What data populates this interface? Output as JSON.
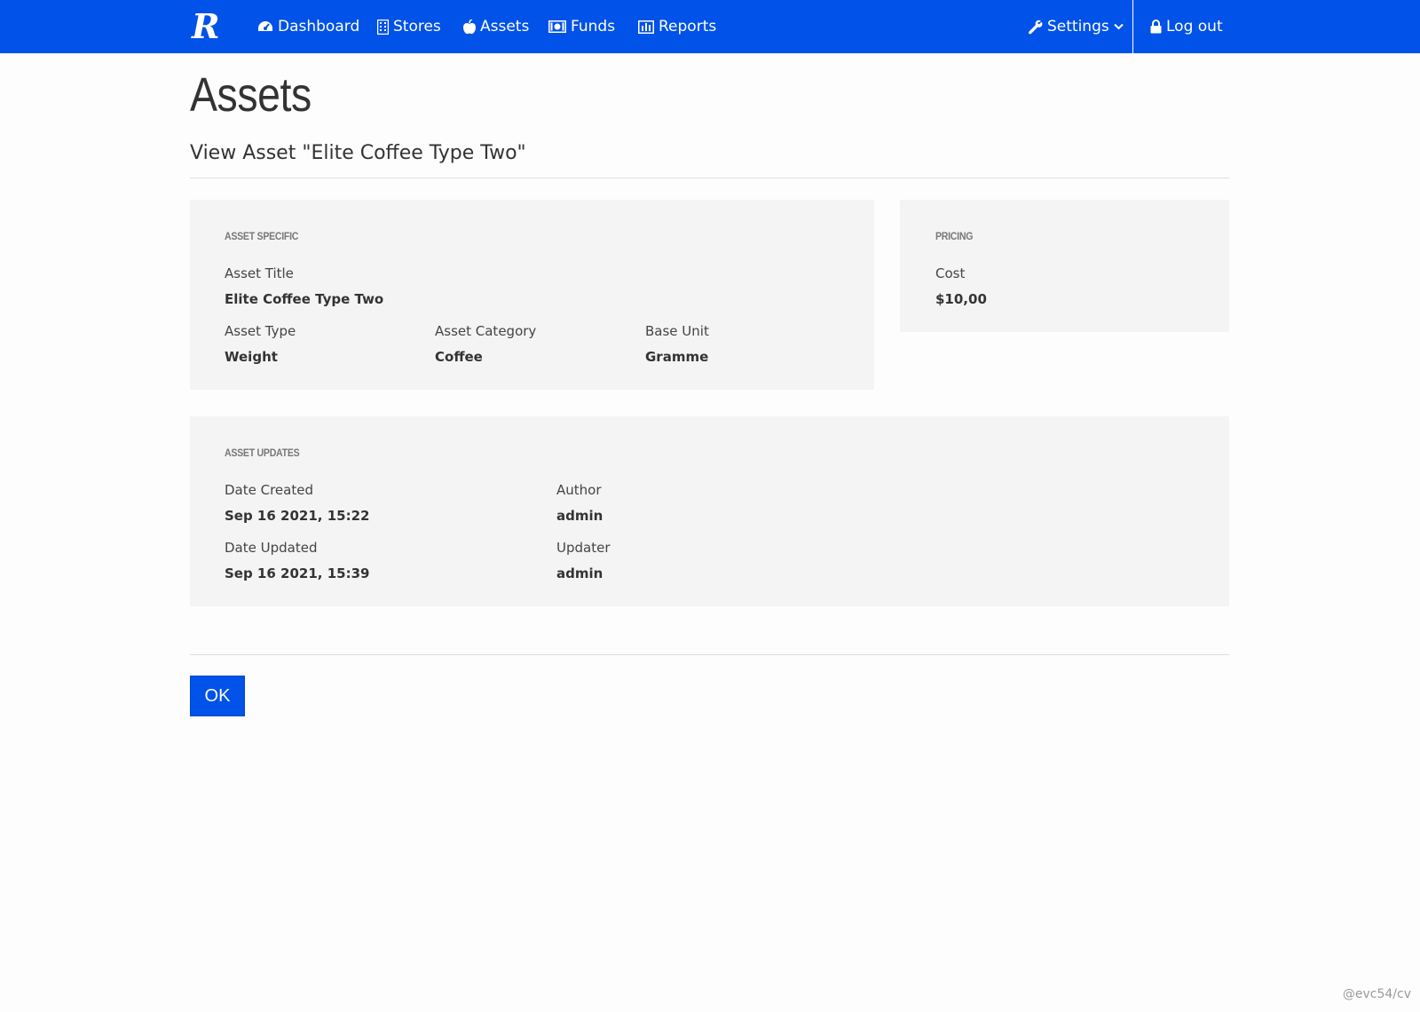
{
  "nav": {
    "brand": "R",
    "items": [
      {
        "label": "Dashboard",
        "icon": "tachometer-icon"
      },
      {
        "label": "Stores",
        "icon": "building-icon"
      },
      {
        "label": "Assets",
        "icon": "apple-icon"
      },
      {
        "label": "Funds",
        "icon": "money-icon"
      },
      {
        "label": "Reports",
        "icon": "bar-chart-icon"
      }
    ],
    "settings": {
      "label": "Settings",
      "icon": "wrench-icon"
    },
    "logout": {
      "label": "Log out",
      "icon": "lock-icon"
    }
  },
  "page": {
    "title": "Assets",
    "subtitle": "View Asset \"Elite Coffee Type Two\""
  },
  "asset_specific": {
    "heading": "ASSET SPECIFIC",
    "title_label": "Asset Title",
    "title_value": "Elite Coffee Type Two",
    "type_label": "Asset Type",
    "type_value": "Weight",
    "category_label": "Asset Category",
    "category_value": "Coffee",
    "unit_label": "Base Unit",
    "unit_value": "Gramme"
  },
  "pricing": {
    "heading": "PRICING",
    "cost_label": "Cost",
    "cost_value": "$10,00"
  },
  "asset_updates": {
    "heading": "ASSET UPDATES",
    "created_label": "Date Created",
    "created_value": "Sep 16 2021, 15:22",
    "author_label": "Author",
    "author_value": "admin",
    "updated_label": "Date Updated",
    "updated_value": "Sep 16 2021, 15:39",
    "updater_label": "Updater",
    "updater_value": "admin"
  },
  "actions": {
    "ok_label": "OK"
  },
  "watermark": "@evc54/cv",
  "colors": {
    "primary": "#0052e8",
    "panel_bg": "#f4f4f4"
  }
}
